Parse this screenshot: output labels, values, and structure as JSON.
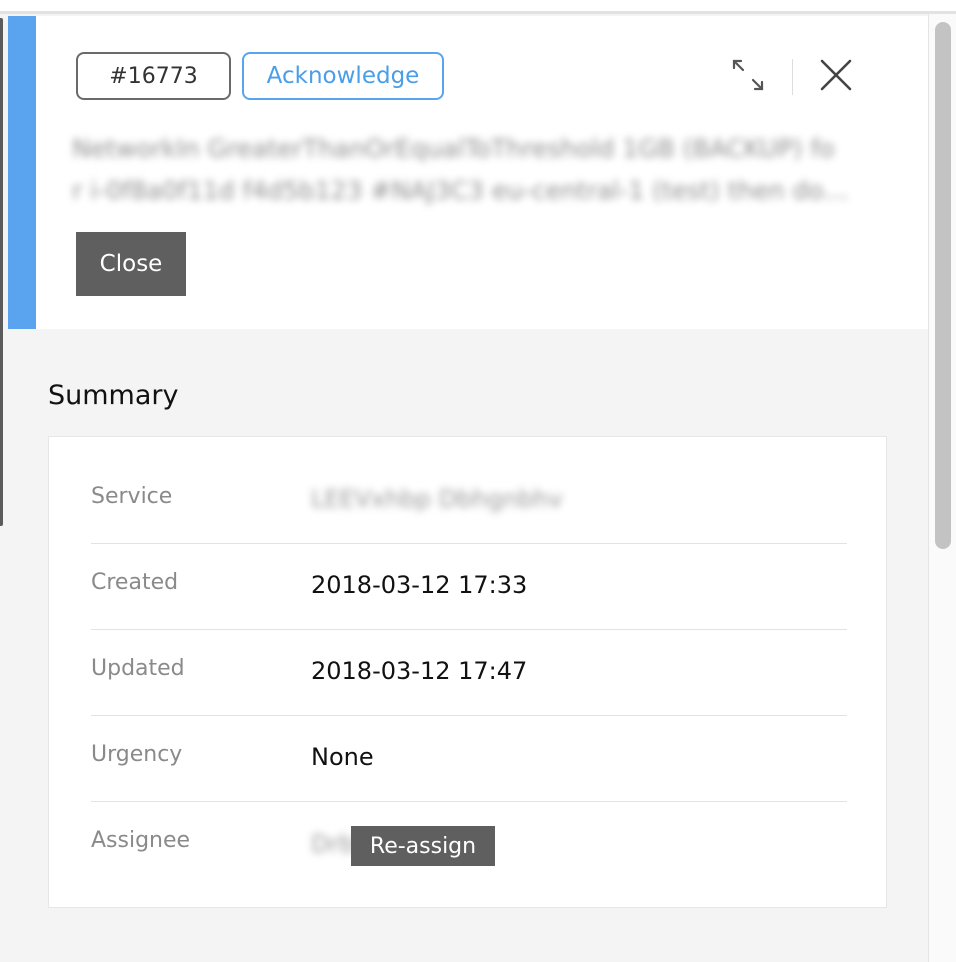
{
  "incident": {
    "id_label": "#16773",
    "acknowledge_label": "Acknowledge",
    "title_line1": "NetworkIn GreaterThanOrEqualToThreshold 1GB (BACKUP) fo",
    "title_line2": "r i-0f8a0f11d f4d5b123 #NAJ3C3 eu-central-1 (test) then do…",
    "close_label": "Close"
  },
  "icons": {
    "expand": "expand-icon",
    "close": "close-icon"
  },
  "summary": {
    "heading": "Summary",
    "rows": [
      {
        "label": "Service",
        "value": "LEEVxhbp Dbhgnbhv"
      },
      {
        "label": "Created",
        "value": "2018-03-12 17:33"
      },
      {
        "label": "Updated",
        "value": "2018-03-12 17:47"
      },
      {
        "label": "Urgency",
        "value": "None"
      },
      {
        "label": "Assignee",
        "value": "Drbh",
        "action_label": "Re-assign"
      }
    ]
  },
  "colors": {
    "accent": "#5aa3ef",
    "dark_button": "#5f5f5f"
  }
}
